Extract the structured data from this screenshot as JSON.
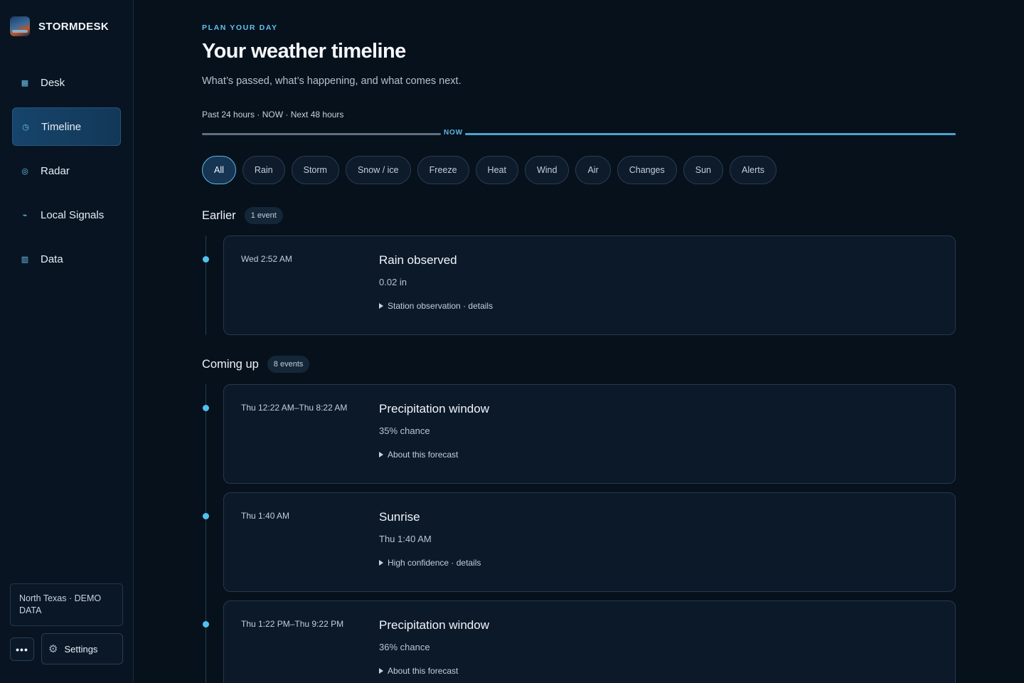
{
  "app": {
    "name": "STORMDESK"
  },
  "nav": [
    {
      "label": "Desk",
      "icon": "grid-icon",
      "glyph": "▦"
    },
    {
      "label": "Timeline",
      "icon": "clock-icon",
      "glyph": "◷",
      "active": true
    },
    {
      "label": "Radar",
      "icon": "radar-icon",
      "glyph": "◎"
    },
    {
      "label": "Local Signals",
      "icon": "signal-icon",
      "glyph": "⌁"
    },
    {
      "label": "Data",
      "icon": "table-icon",
      "glyph": "▥"
    }
  ],
  "sidebar_footer": {
    "region": "North Texas · DEMO DATA",
    "more": "•••",
    "settings": "Settings"
  },
  "header": {
    "eyebrow": "PLAN YOUR DAY",
    "title": "Your weather timeline",
    "subtitle": "What’s passed, what’s happening, and what comes next.",
    "range": "Past 24 hours · NOW · Next 48 hours",
    "now_tag": "NOW"
  },
  "filters": [
    "All",
    "Rain",
    "Storm",
    "Snow / ice",
    "Freeze",
    "Heat",
    "Wind",
    "Air",
    "Changes",
    "Sun",
    "Alerts"
  ],
  "active_filter": "All",
  "sections": {
    "earlier": {
      "title": "Earlier",
      "count": "1 event",
      "events": [
        {
          "time": "Wed 2:52 AM",
          "title": "Rain observed",
          "value": "0.02 in",
          "details": "Station observation · details"
        }
      ]
    },
    "upcoming": {
      "title": "Coming up",
      "count": "8 events",
      "events": [
        {
          "time": "Thu 12:22 AM–Thu 8:22 AM",
          "title": "Precipitation window",
          "value": "35% chance",
          "details": "About this forecast"
        },
        {
          "time": "Thu 1:40 AM",
          "title": "Sunrise",
          "value": "Thu 1:40 AM",
          "details": "High confidence · details"
        },
        {
          "time": "Thu 1:22 PM–Thu 9:22 PM",
          "title": "Precipitation window",
          "value": "36% chance",
          "details": "About this forecast"
        }
      ]
    }
  },
  "colors": {
    "accent": "#54c0ee",
    "background": "#07111c",
    "sidebar": "#081422",
    "card": "#0b1929"
  }
}
